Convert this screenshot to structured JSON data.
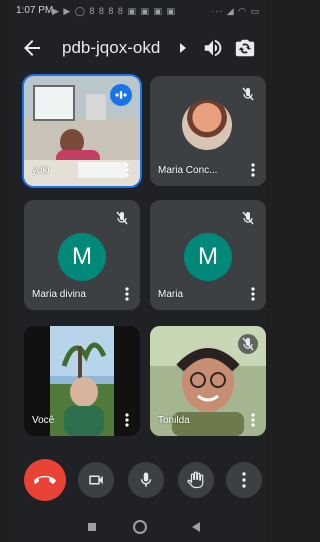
{
  "status_bar": {
    "time": "1:07 PM",
    "left_icons": "▶ ▶ ◯ 8 8 8 8 ▣ ▣ ▣ ▣",
    "right_icons": "··· ◢ ◠ ▭"
  },
  "meeting": {
    "code": "pdb-jqox-okd"
  },
  "participants": [
    {
      "name": "yuki",
      "muted": false,
      "speaking": true,
      "type": "video"
    },
    {
      "name": "Maria Conc...",
      "muted": true,
      "type": "photo"
    },
    {
      "name": "Maria divina",
      "muted": true,
      "type": "initial",
      "initial": "M"
    },
    {
      "name": "Maria",
      "muted": true,
      "type": "initial",
      "initial": "M"
    },
    {
      "name": "Você",
      "muted": false,
      "type": "video"
    },
    {
      "name": "Tonilda",
      "muted": true,
      "type": "video"
    }
  ],
  "colors": {
    "background": "#202124",
    "tile": "#3c4043",
    "avatar": "#00897b",
    "end_call": "#ea4335",
    "accent": "#1a73e8"
  },
  "controls": [
    "end-call",
    "camera",
    "microphone",
    "raise-hand",
    "more-options"
  ]
}
